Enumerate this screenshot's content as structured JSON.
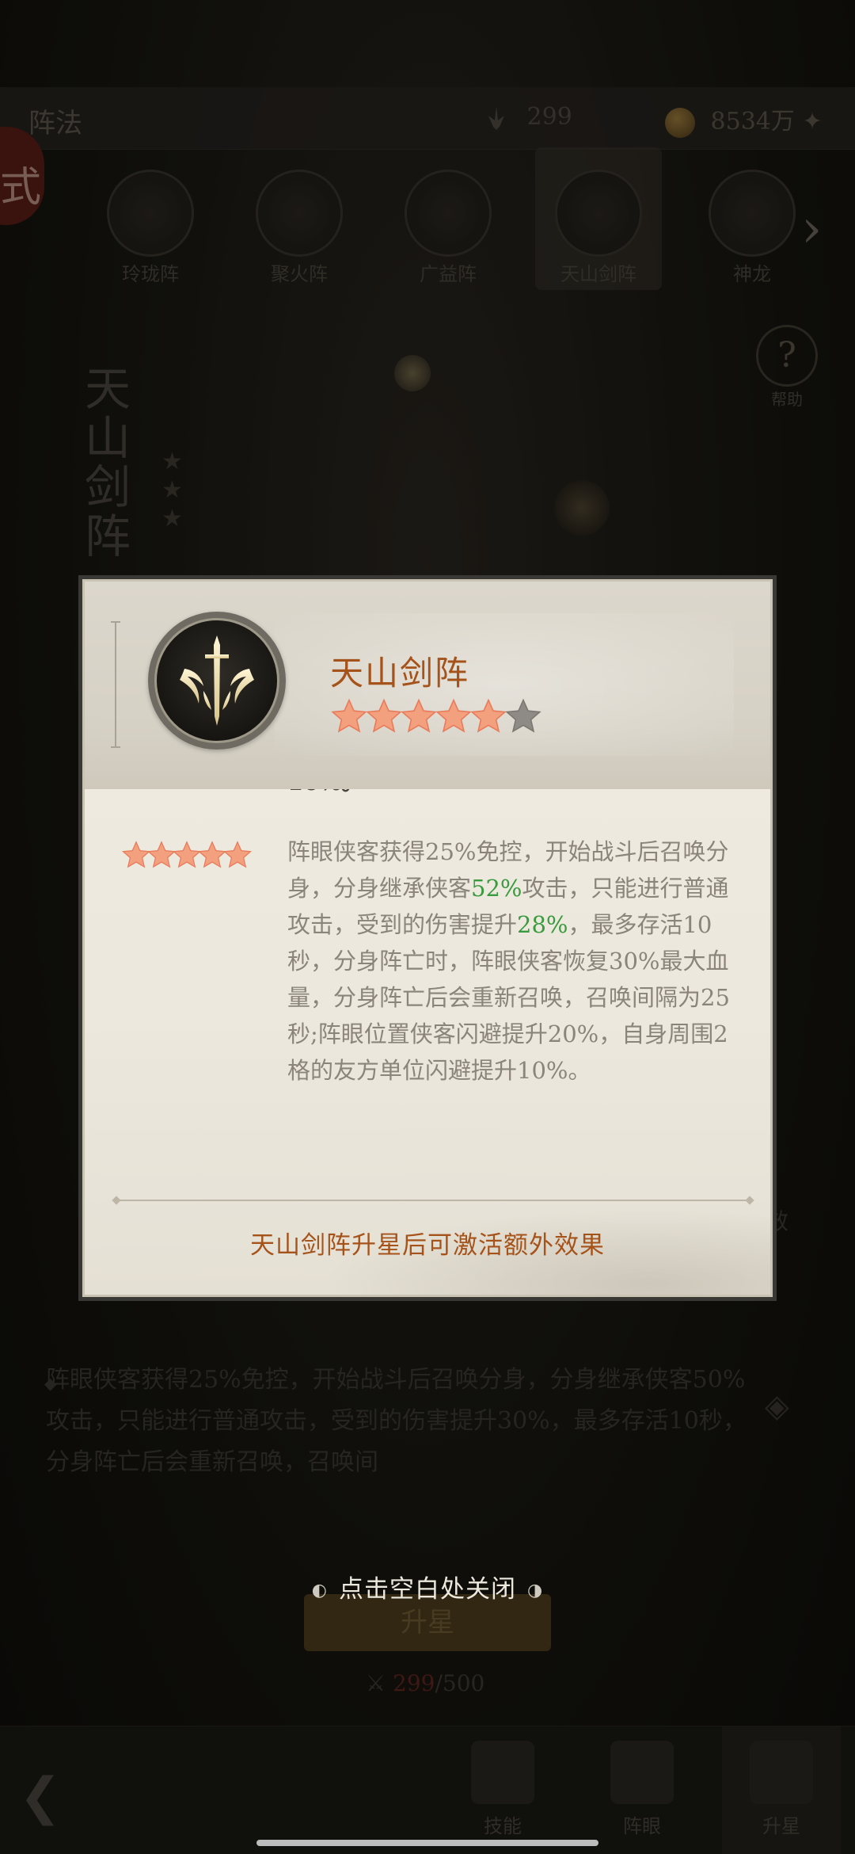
{
  "background": {
    "top_title": "阵法",
    "resource_1": "299",
    "resource_2": "8534万",
    "seal_char": "式",
    "formations": [
      {
        "label": "玲珑阵"
      },
      {
        "label": "聚火阵"
      },
      {
        "label": "广益阵"
      },
      {
        "label": "天山剑阵"
      },
      {
        "label": "神龙"
      }
    ],
    "help_label": "帮助",
    "vertical_title": "天山剑阵",
    "description": "阵眼侠客获得25%免控，开始战斗后召唤分身，分身继承侠客50%攻击，只能进行普通攻击，受到的伤害提升30%，最多存活10秒，分身阵亡后会重新召唤，召唤间",
    "upgrade_button": "升星",
    "cost_current": "299",
    "cost_total": "/500",
    "nav": [
      {
        "label": "返回"
      },
      {
        "label": "技能"
      },
      {
        "label": "阵眼"
      },
      {
        "label": "升星"
      }
    ]
  },
  "modal": {
    "title": "天山剑阵",
    "rating": 5,
    "max_rating": 6,
    "partial_text": "升20%，自身周围2格的友方单位闪避提升10%。",
    "entry": {
      "stars": 5,
      "segments": [
        "阵眼侠客获得25%免控，开始战斗后召唤分身，分身继承侠客",
        "52%",
        "攻击，只能进行普通攻击，受到的伤害提升",
        "28%",
        "，最多存活10秒，分身阵亡时，阵眼侠客恢复30%最大血量，分身阵亡后会重新召唤，召唤间隔为25秒;阵眼位置侠客闪避提升20%，自身周围2格的友方单位闪避提升10%。"
      ]
    },
    "footer_note": "天山剑阵升星后可激活额外效果"
  },
  "close_hint": "点击空白处关闭",
  "colors": {
    "accent_orange": "#a5531a",
    "highlight_green": "#3a9a3e",
    "star_fill": "#f2a07e",
    "star_empty": "#8e8b86"
  }
}
